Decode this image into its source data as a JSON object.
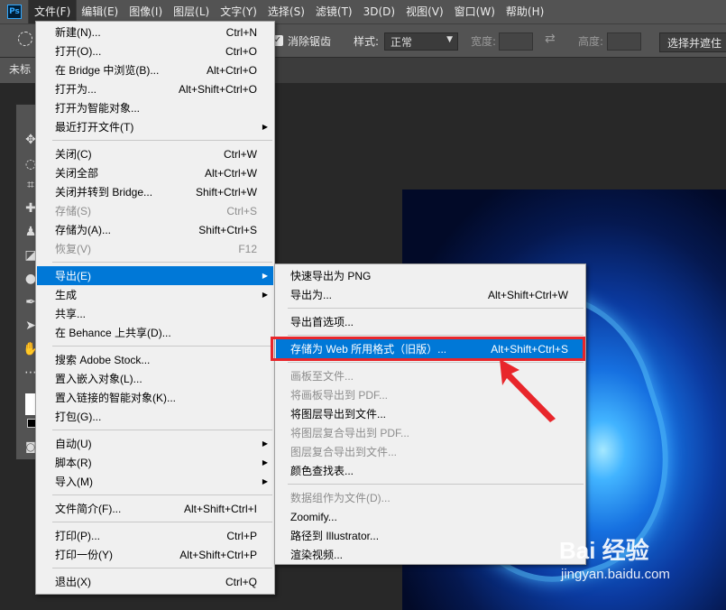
{
  "app": {
    "logo": "Ps"
  },
  "menubar": {
    "items": [
      "文件(F)",
      "编辑(E)",
      "图像(I)",
      "图层(L)",
      "文字(Y)",
      "选择(S)",
      "滤镜(T)",
      "3D(D)",
      "视图(V)",
      "窗口(W)",
      "帮助(H)"
    ],
    "active_index": 0
  },
  "options_bar": {
    "antialias_label": "消除锯齿",
    "style_label": "样式:",
    "style_value": "正常",
    "width_label": "宽度:",
    "height_label": "高度:",
    "select_mask_button": "选择并遮住"
  },
  "doc_tab": {
    "title": "未标"
  },
  "file_menu": {
    "items": [
      {
        "label": "新建(N)...",
        "shortcut": "Ctrl+N"
      },
      {
        "label": "打开(O)...",
        "shortcut": "Ctrl+O"
      },
      {
        "label": "在 Bridge 中浏览(B)...",
        "shortcut": "Alt+Ctrl+O"
      },
      {
        "label": "打开为...",
        "shortcut": "Alt+Shift+Ctrl+O"
      },
      {
        "label": "打开为智能对象...",
        "shortcut": ""
      },
      {
        "label": "最近打开文件(T)",
        "shortcut": "",
        "submenu": true
      },
      {
        "separator": true
      },
      {
        "label": "关闭(C)",
        "shortcut": "Ctrl+W"
      },
      {
        "label": "关闭全部",
        "shortcut": "Alt+Ctrl+W"
      },
      {
        "label": "关闭并转到 Bridge...",
        "shortcut": "Shift+Ctrl+W"
      },
      {
        "label": "存储(S)",
        "shortcut": "Ctrl+S",
        "disabled": true
      },
      {
        "label": "存储为(A)...",
        "shortcut": "Shift+Ctrl+S"
      },
      {
        "label": "恢复(V)",
        "shortcut": "F12",
        "disabled": true
      },
      {
        "separator": true
      },
      {
        "label": "导出(E)",
        "shortcut": "",
        "submenu": true,
        "highlighted": true
      },
      {
        "label": "生成",
        "shortcut": "",
        "submenu": true
      },
      {
        "label": "共享...",
        "shortcut": ""
      },
      {
        "label": "在 Behance 上共享(D)...",
        "shortcut": ""
      },
      {
        "separator": true
      },
      {
        "label": "搜索 Adobe Stock...",
        "shortcut": ""
      },
      {
        "label": "置入嵌入对象(L)...",
        "shortcut": ""
      },
      {
        "label": "置入链接的智能对象(K)...",
        "shortcut": ""
      },
      {
        "label": "打包(G)...",
        "shortcut": ""
      },
      {
        "separator": true
      },
      {
        "label": "自动(U)",
        "shortcut": "",
        "submenu": true
      },
      {
        "label": "脚本(R)",
        "shortcut": "",
        "submenu": true
      },
      {
        "label": "导入(M)",
        "shortcut": "",
        "submenu": true
      },
      {
        "separator": true
      },
      {
        "label": "文件简介(F)...",
        "shortcut": "Alt+Shift+Ctrl+I"
      },
      {
        "separator": true
      },
      {
        "label": "打印(P)...",
        "shortcut": "Ctrl+P"
      },
      {
        "label": "打印一份(Y)",
        "shortcut": "Alt+Shift+Ctrl+P"
      },
      {
        "separator": true
      },
      {
        "label": "退出(X)",
        "shortcut": "Ctrl+Q"
      }
    ]
  },
  "export_menu": {
    "items": [
      {
        "label": "快速导出为 PNG",
        "shortcut": ""
      },
      {
        "label": "导出为...",
        "shortcut": "Alt+Shift+Ctrl+W"
      },
      {
        "separator": true
      },
      {
        "label": "导出首选项...",
        "shortcut": ""
      },
      {
        "separator": true
      },
      {
        "label": "存储为 Web 所用格式（旧版）...",
        "shortcut": "Alt+Shift+Ctrl+S",
        "highlighted": true
      },
      {
        "separator": true
      },
      {
        "label": "画板至文件...",
        "shortcut": "",
        "disabled": true
      },
      {
        "label": "将画板导出到 PDF...",
        "shortcut": "",
        "disabled": true
      },
      {
        "label": "将图层导出到文件...",
        "shortcut": ""
      },
      {
        "label": "将图层复合导出到 PDF...",
        "shortcut": "",
        "disabled": true
      },
      {
        "label": "图层复合导出到文件...",
        "shortcut": "",
        "disabled": true
      },
      {
        "label": "颜色查找表...",
        "shortcut": ""
      },
      {
        "separator": true
      },
      {
        "label": "数据组作为文件(D)...",
        "shortcut": "",
        "disabled": true
      },
      {
        "label": "Zoomify...",
        "shortcut": ""
      },
      {
        "label": "路径到 Illustrator...",
        "shortcut": ""
      },
      {
        "label": "渲染视频...",
        "shortcut": ""
      }
    ]
  },
  "watermark": {
    "brand": "Bai 经验",
    "url": "jingyan.baidu.com"
  },
  "colors": {
    "highlight": "#0078d7",
    "annotation": "#e8262b"
  }
}
